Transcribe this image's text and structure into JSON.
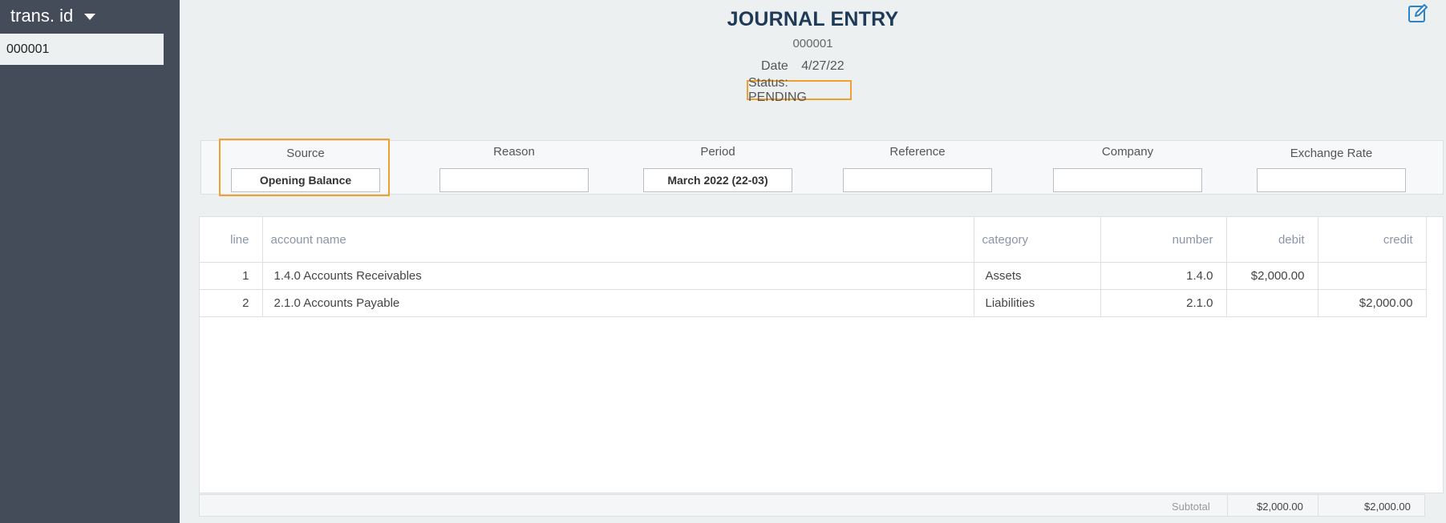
{
  "sidebar": {
    "header_label": "trans. id",
    "items": [
      "000001"
    ]
  },
  "header": {
    "title": "JOURNAL ENTRY",
    "entry_id": "000001",
    "date_label": "Date",
    "date_value": "4/27/22",
    "status": "Status: PENDING"
  },
  "fields": {
    "source": {
      "label": "Source",
      "value": "Opening Balance"
    },
    "reason": {
      "label": "Reason",
      "value": ""
    },
    "period": {
      "label": "Period",
      "value": "March 2022 (22-03)"
    },
    "reference": {
      "label": "Reference",
      "value": ""
    },
    "company": {
      "label": "Company",
      "value": ""
    },
    "exchange_rate": {
      "label": "Exchange Rate",
      "value": ""
    }
  },
  "table": {
    "columns": [
      "line",
      "account name",
      "category",
      "number",
      "debit",
      "credit"
    ],
    "rows": [
      {
        "line": "1",
        "account_name": "1.4.0 Accounts Receivables",
        "category": "Assets",
        "number": "1.4.0",
        "debit": "$2,000.00",
        "credit": ""
      },
      {
        "line": "2",
        "account_name": "2.1.0 Accounts Payable",
        "category": "Liabilities",
        "number": "2.1.0",
        "debit": "",
        "credit": "$2,000.00"
      }
    ]
  },
  "subtotal": {
    "label": "Subtotal",
    "debit": "$2,000.00",
    "credit": "$2,000.00"
  },
  "colors": {
    "sidebar_bg": "#444c5a",
    "highlight": "#f0a030",
    "title": "#1e3a57",
    "icon": "#2c83c7"
  },
  "icons": [
    "caret-down-icon",
    "edit-icon"
  ]
}
